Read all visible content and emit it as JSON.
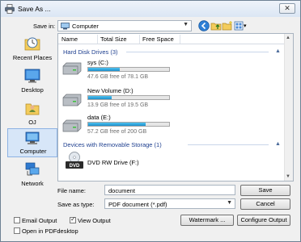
{
  "window": {
    "title": "Save As ...",
    "close_glyph": "✕"
  },
  "toolbar": {
    "save_in_label": "Save in:",
    "location": "Computer",
    "arrow": "▼",
    "views_arrow": "▾"
  },
  "places": [
    {
      "label": "Recent Places",
      "icon": "recent-places-icon"
    },
    {
      "label": "Desktop",
      "icon": "desktop-icon"
    },
    {
      "label": "OJ",
      "icon": "user-folder-icon"
    },
    {
      "label": "Computer",
      "icon": "computer-icon"
    },
    {
      "label": "Network",
      "icon": "network-icon"
    }
  ],
  "columns": [
    "Name",
    "Total Size",
    "Free Space"
  ],
  "groups": {
    "hdd": {
      "label": "Hard Disk Drives (3)",
      "chevron": "▲"
    },
    "removable": {
      "label": "Devices with Removable Storage (1)",
      "chevron": "▲"
    }
  },
  "drives": [
    {
      "name": "sys (C:)",
      "free": "47.6 GB free of 78.1 GB",
      "used_fraction": 0.39
    },
    {
      "name": "New Volume (D:)",
      "free": "13.9 GB free of 19.5 GB",
      "used_fraction": 0.29
    },
    {
      "name": "data (E:)",
      "free": "57.2 GB free of 200 GB",
      "used_fraction": 0.71
    }
  ],
  "removable": [
    {
      "name": "DVD RW Drive (F:)",
      "icon_text": "DVD"
    }
  ],
  "form": {
    "file_name_label": "File name:",
    "file_name_value": "document",
    "save_type_label": "Save as type:",
    "save_type_value": "PDF document (*.pdf)"
  },
  "buttons": {
    "save": "Save",
    "cancel": "Cancel",
    "watermark": "Watermark ...",
    "configure": "Configure Output"
  },
  "options": {
    "email_output": {
      "label": "Email Output",
      "checked": false
    },
    "view_output": {
      "label": "View Output",
      "checked": true,
      "mark": "✓"
    },
    "open_pdfdesktop": {
      "label": "Open in PDFdesktop",
      "checked": false
    }
  },
  "colors": {
    "accent": "#1e3f8f",
    "bar_fill": "#1e8fcb",
    "selection": "#d7e6f8"
  }
}
